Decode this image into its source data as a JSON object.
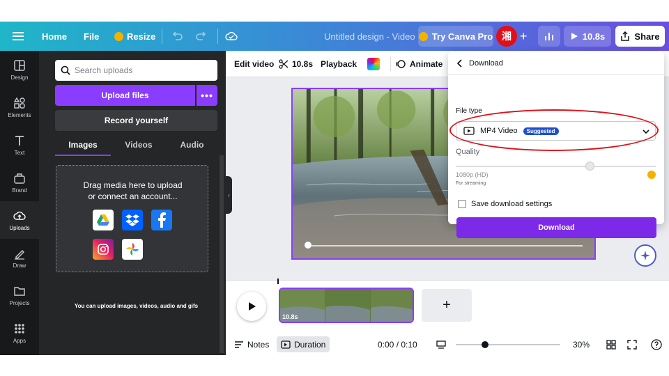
{
  "topbar": {
    "home": "Home",
    "file": "File",
    "resize": "Resize",
    "doc_title": "Untitled design - Video",
    "try_pro": "Try Canva Pro",
    "avatar": "湘",
    "play_duration": "10.8s",
    "share": "Share",
    "colors": {
      "accent": "#8b3dff",
      "crown": "#f5b100",
      "avatar_bg": "#e0101a"
    }
  },
  "rail": {
    "items": [
      {
        "label": "Design",
        "icon": "layout-icon"
      },
      {
        "label": "Elements",
        "icon": "shapes-icon"
      },
      {
        "label": "Text",
        "icon": "text-icon"
      },
      {
        "label": "Brand",
        "icon": "brand-icon"
      },
      {
        "label": "Uploads",
        "icon": "cloud-upload-icon"
      },
      {
        "label": "Draw",
        "icon": "pen-icon"
      },
      {
        "label": "Projects",
        "icon": "folder-icon"
      },
      {
        "label": "Apps",
        "icon": "apps-grid-icon"
      }
    ],
    "active_index": 4
  },
  "uploads": {
    "search_placeholder": "Search uploads",
    "upload_files": "Upload files",
    "record_yourself": "Record yourself",
    "tabs": [
      "Images",
      "Videos",
      "Audio"
    ],
    "active_tab": 0,
    "drop_line1": "Drag media here to upload",
    "drop_line2": "or connect an account...",
    "sources": [
      "google-drive-icon",
      "dropbox-icon",
      "facebook-icon",
      "instagram-icon",
      "google-photos-icon"
    ],
    "hint": "You can upload images, videos, audio and gifs"
  },
  "editor_toolbar": {
    "edit_video": "Edit video",
    "duration": "10.8s",
    "playback": "Playback",
    "animate": "Animate"
  },
  "timeline": {
    "clip_duration": "10.8s",
    "add_symbol": "+"
  },
  "bottombar": {
    "notes": "Notes",
    "duration": "Duration",
    "time": "0:00 / 0:10",
    "zoom": "30%",
    "zoom_fraction": 0.28
  },
  "download": {
    "title": "Download",
    "file_type_label": "File type",
    "file_type_value": "MP4 Video",
    "suggested": "Suggested",
    "quality_label": "Quality",
    "quality_value": "1080p (HD)",
    "quality_use": "For streaming",
    "quality_fraction": 0.67,
    "save_settings": "Save download settings",
    "button": "Download"
  }
}
